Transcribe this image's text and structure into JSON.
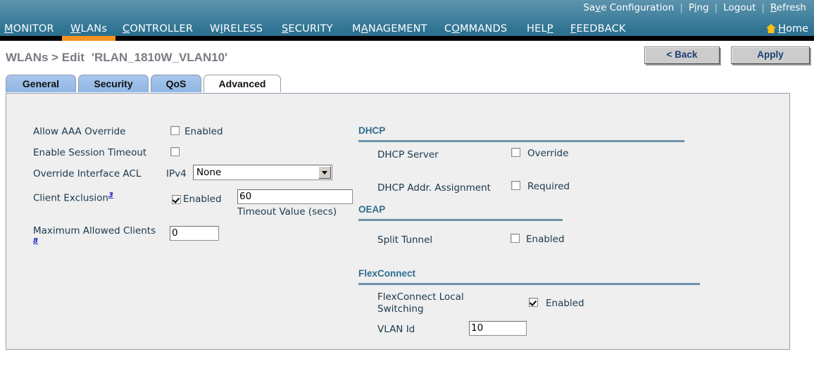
{
  "header": {
    "top_links": [
      {
        "label": "Save Configuration",
        "accesskey_index": 3
      },
      {
        "label": "Ping",
        "accesskey_index": 1
      },
      {
        "label": "Logout",
        "accesskey_index": 3
      },
      {
        "label": "Refresh",
        "accesskey_index": 0
      }
    ],
    "separator": "|",
    "menu": [
      {
        "label": "MONITOR",
        "active": false
      },
      {
        "label": "WLANs",
        "active": true
      },
      {
        "label": "CONTROLLER",
        "active": false
      },
      {
        "label": "WIRELESS",
        "active": false
      },
      {
        "label": "SECURITY",
        "active": false
      },
      {
        "label": "MANAGEMENT",
        "active": false
      },
      {
        "label": "COMMANDS",
        "active": false
      },
      {
        "label": "HELP",
        "active": false
      },
      {
        "label": "FEEDBACK",
        "active": false
      }
    ],
    "home_label": "Home",
    "home_icon": "home-icon",
    "accent_color": "#f59222",
    "bar_color": "#2e7392"
  },
  "title": {
    "breadcrumb": "WLANs > Edit",
    "wlan_name": "'RLAN_1810W_VLAN10'"
  },
  "buttons": {
    "back": "< Back",
    "apply": "Apply"
  },
  "tabs": [
    {
      "label": "General",
      "active": false
    },
    {
      "label": "Security",
      "active": false
    },
    {
      "label": "QoS",
      "active": false
    },
    {
      "label": "Advanced",
      "active": true
    }
  ],
  "left_column": {
    "aaa_override": {
      "label": "Allow AAA Override",
      "checkbox_label": "Enabled",
      "checked": false
    },
    "session_timeout": {
      "label": "Enable Session Timeout",
      "checked": false
    },
    "override_interface_acl": {
      "label": "Override Interface ACL",
      "ipv4_label": "IPv4",
      "ipv4_value": "None",
      "ipv4_options": [
        "None"
      ]
    },
    "client_exclusion": {
      "label": "Client Exclusion",
      "footnote": "3",
      "checkbox_label": "Enabled",
      "checked": true,
      "timeout_value": "60",
      "timeout_caption": "Timeout Value (secs)"
    },
    "max_clients": {
      "label": "Maximum Allowed Clients",
      "footnote": "8",
      "value": "0"
    }
  },
  "right_column": {
    "dhcp": {
      "title": "DHCP",
      "server": {
        "label": "DHCP Server",
        "checkbox_label": "Override",
        "checked": false
      },
      "addr_assignment": {
        "label": "DHCP Addr. Assignment",
        "checkbox_label": "Required",
        "checked": false
      }
    },
    "oeap": {
      "title": "OEAP",
      "split_tunnel": {
        "label": "Split Tunnel",
        "checkbox_label": "Enabled",
        "checked": false
      }
    },
    "flexconnect": {
      "title": "FlexConnect",
      "local_switching": {
        "label": "FlexConnect Local Switching",
        "checkbox_label": "Enabled",
        "checked": true
      },
      "vlan_id": {
        "label": "VLAN Id",
        "value": "10"
      }
    }
  }
}
